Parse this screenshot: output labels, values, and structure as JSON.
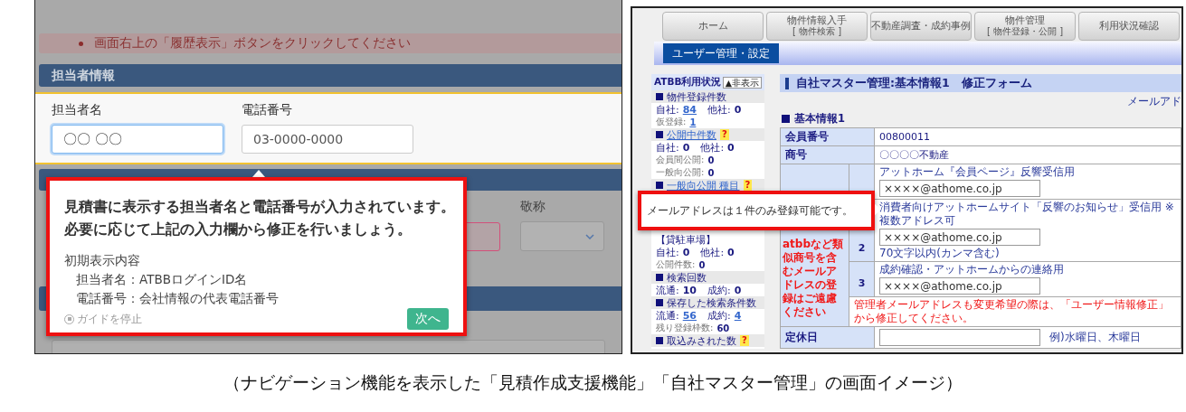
{
  "left_screen": {
    "alert": "画面右上の「履歴表示」ボタンをクリックしてください",
    "section_header": "担当者情報",
    "fields": [
      {
        "label": "担当者名",
        "value": "〇〇 〇〇",
        "focused": true
      },
      {
        "label": "電話番号",
        "value": "03-0000-0000",
        "focused": false
      }
    ],
    "background_label": "敬称",
    "guide": {
      "message_lines": [
        "見積書に表示する担当者名と電話番号が入力されています。",
        "必要に応じて上記の入力欄から修正を行いましょう。"
      ],
      "details_title": "初期表示内容",
      "details": [
        "担当者名：ATBBログインID名",
        "電話番号：会社情報の代表電話番号"
      ],
      "stop_link": "ガイドを停止",
      "next_button": "次へ"
    }
  },
  "right_screen": {
    "nav_tabs": [
      {
        "label": "ホーム"
      },
      {
        "label": "物件情報入手",
        "sub": "[ 物件検索 ]"
      },
      {
        "label": "不動産調査・成約事例"
      },
      {
        "label": "物件管理",
        "sub": "[ 物件登録・公開 ]"
      },
      {
        "label": "利用状況確認"
      }
    ],
    "sub_nav": [
      {
        "label": "ユーザー管理・設定",
        "selected": true
      }
    ],
    "sidebar": {
      "title": "ATBB利用状況",
      "toggle": "▲非表示",
      "rows_above_popup": [
        {
          "kind": "heading",
          "label": "物件登録件数",
          "link": false
        },
        {
          "kind": "stats",
          "small": false,
          "pairs": [
            {
              "label": "自社:",
              "value": "84",
              "link": true
            },
            {
              "label": "他社:",
              "value": "0",
              "link": false
            }
          ]
        },
        {
          "kind": "stats",
          "small": true,
          "pairs": [
            {
              "label": "仮登録:",
              "value": "1",
              "link": true
            }
          ]
        },
        {
          "kind": "heading",
          "label": "公開中件数",
          "link": true,
          "help": "?"
        },
        {
          "kind": "stats",
          "small": false,
          "pairs": [
            {
              "label": "自社:",
              "value": "0",
              "link": false
            },
            {
              "label": "他社:",
              "value": "0",
              "link": false
            }
          ]
        },
        {
          "kind": "stats",
          "small": true,
          "pairs": [
            {
              "label": "会員間公開:",
              "value": "0",
              "link": false
            }
          ]
        },
        {
          "kind": "stats",
          "small": true,
          "pairs": [
            {
              "label": "一般向公開:",
              "value": "0",
              "link": false
            }
          ]
        },
        {
          "kind": "heading",
          "label": "一般向公開 種目",
          "link": true,
          "help": "?"
        }
      ],
      "rows_below_popup": [
        {
          "kind": "plain",
          "label": "【貸駐車場】"
        },
        {
          "kind": "stats",
          "small": false,
          "pairs": [
            {
              "label": "自社:",
              "value": "0",
              "link": false
            },
            {
              "label": "他社:",
              "value": "0",
              "link": false
            }
          ]
        },
        {
          "kind": "stats",
          "small": true,
          "pairs": [
            {
              "label": "公開件数:",
              "value": "0",
              "link": false
            }
          ]
        },
        {
          "kind": "heading",
          "label": "検索回数",
          "link": false
        },
        {
          "kind": "stats",
          "small": false,
          "pairs": [
            {
              "label": "流通:",
              "value": "10",
              "link": false
            },
            {
              "label": "成約:",
              "value": "0",
              "link": false
            }
          ]
        },
        {
          "kind": "heading",
          "label": "保存した検索条件数",
          "link": false
        },
        {
          "kind": "stats",
          "small": false,
          "pairs": [
            {
              "label": "流通:",
              "value": "56",
              "link": true
            },
            {
              "label": "成約:",
              "value": "4",
              "link": true
            }
          ]
        },
        {
          "kind": "stats",
          "small": true,
          "pairs": [
            {
              "label": "残り登録枠数:",
              "value": "60",
              "link": false
            }
          ]
        },
        {
          "kind": "heading",
          "label": "取込みされた数",
          "link": false,
          "help": "?"
        }
      ]
    },
    "title": "自社マスター管理:基本情報1　修正フォーム",
    "top_link": "メールアド",
    "section": "基本情報1",
    "table": [
      {
        "kind": "simple",
        "label": "会員番号",
        "value": "00800011"
      },
      {
        "kind": "simple",
        "label": "商号",
        "value": "〇〇〇〇不動産"
      },
      {
        "kind": "email_group",
        "note": "atbbなど類似商号を含むメールアドレスの登録はご遠慮ください",
        "entries": [
          {
            "caption": "アットホーム『会員ページ』反響受信用",
            "value": "××××@athome.co.jp"
          },
          {
            "number": "2",
            "caption": "消費者向けアットホームサイト「反響のお知らせ」受信用 ※複数アドレス可",
            "value": "××××@athome.co.jp",
            "hint": "70文字以内(カンマ含む)"
          },
          {
            "number": "3",
            "caption": "成約確認・アットホームからの連絡用",
            "value": "××××@athome.co.jp"
          }
        ],
        "footer": "管理者メールアドレスも変更希望の際は、「ユーザー情報修正」から修正してください。"
      },
      {
        "kind": "input",
        "label": "定休日",
        "hint": "例)水曜日、木曜日"
      }
    ],
    "popup": "メールアドレスは１件のみ登録可能です。"
  },
  "caption": "（ナビゲーション機能を表示した「見積作成支援機能」「自社マスター管理」の画面イメージ）"
}
